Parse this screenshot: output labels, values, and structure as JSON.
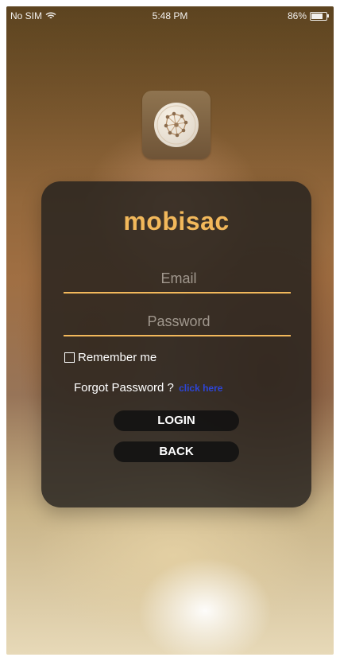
{
  "status_bar": {
    "carrier": "No SIM",
    "time": "5:48 PM",
    "battery": "86%",
    "battery_level": 0.86
  },
  "app": {
    "name": "mobisac"
  },
  "login_form": {
    "email_placeholder": "Email",
    "password_placeholder": "Password",
    "remember_me_label": "Remember me",
    "forgot_password_text": "Forgot Password ?",
    "forgot_password_link": "click here",
    "login_button": "LOGIN",
    "back_button": "BACK"
  },
  "icons": {
    "wifi": "wifi-icon",
    "battery": "battery-icon",
    "logo": "app-logo-icon",
    "checkbox": "checkbox-icon"
  },
  "colors": {
    "accent": "#f2b85b",
    "link": "#2d45d7",
    "card": "#26231f",
    "button": "#111111"
  }
}
